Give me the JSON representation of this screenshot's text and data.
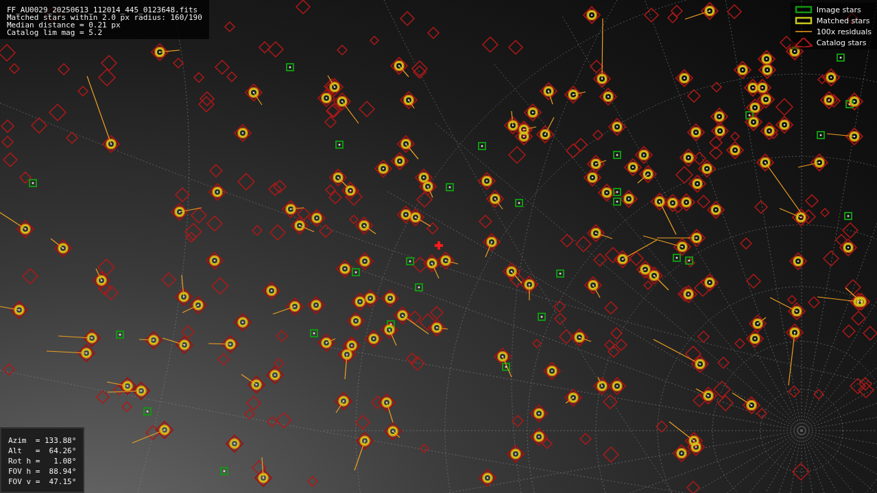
{
  "file_info": {
    "lines": [
      "FF_AU0029_20250613_112014_445_0123648.fits",
      "Matched stars within 2.0 px radius: 160/190",
      "Median distance = 0.21 px",
      "Catalog lim mag = 5.2"
    ]
  },
  "legend": [
    {
      "kind": "image",
      "label": "Image stars"
    },
    {
      "kind": "matched",
      "label": "Matched stars"
    },
    {
      "kind": "residual",
      "label": "100x residuals"
    },
    {
      "kind": "catalog",
      "label": "Catalog stars"
    }
  ],
  "pointing": {
    "rows": [
      "Azim  = 133.88°",
      "Alt   =  64.26°",
      "Rot h =   1.08°",
      "FOV h =  88.94°",
      "FOV v =  47.15°"
    ]
  }
}
